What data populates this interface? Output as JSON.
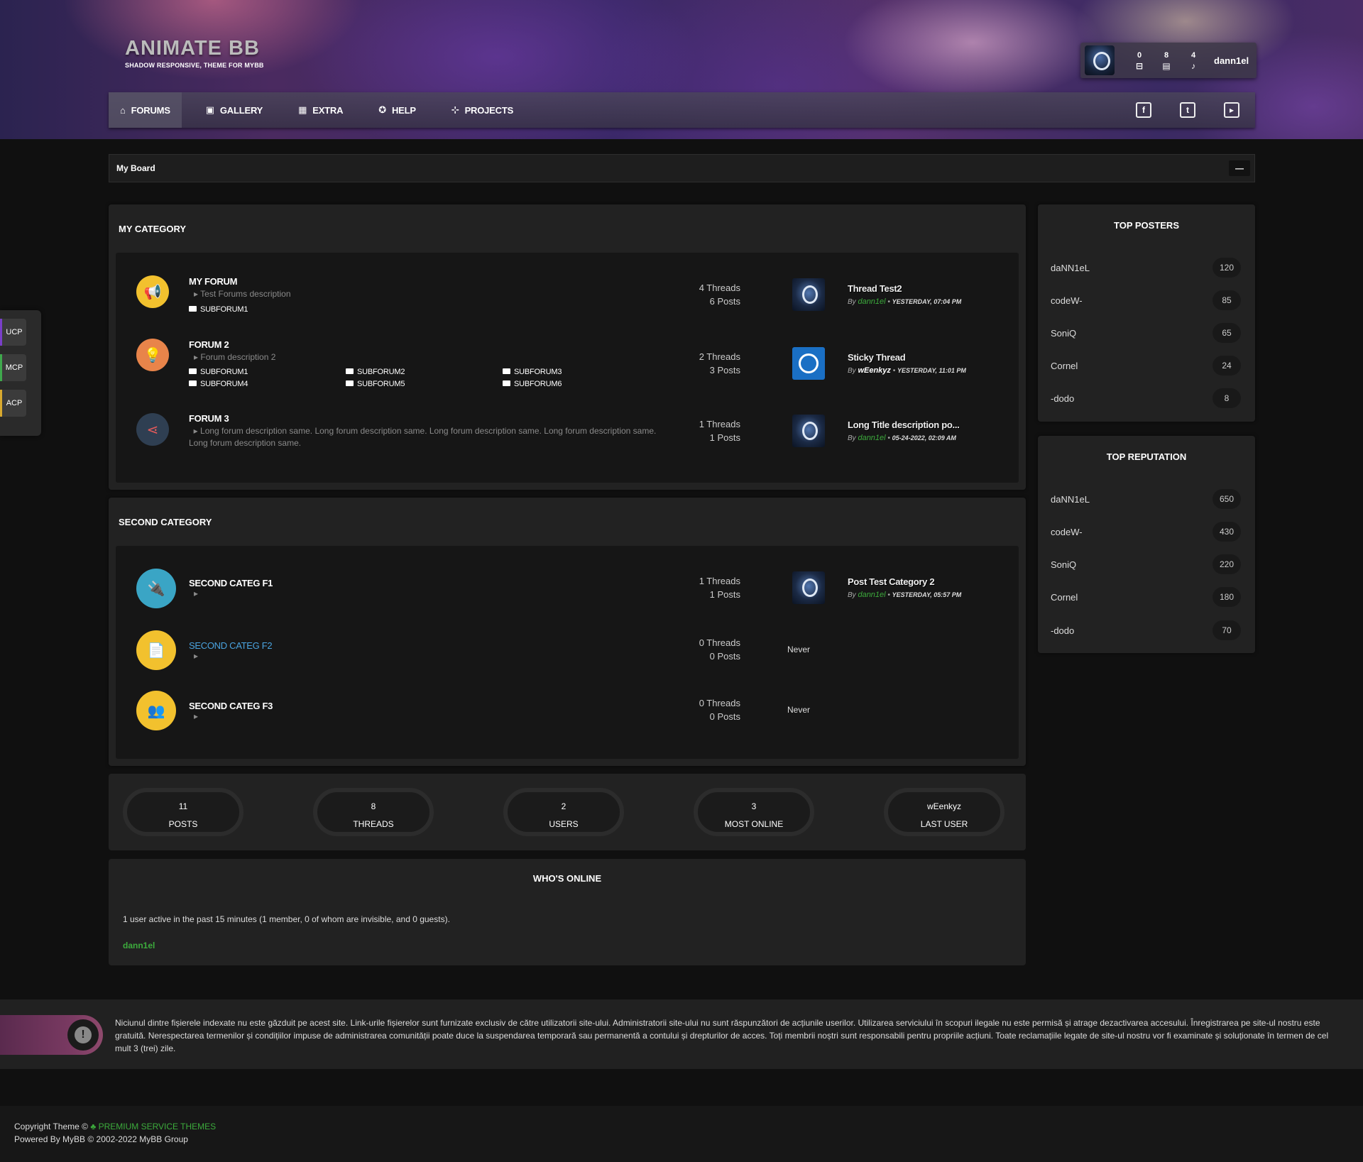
{
  "header": {
    "title": "ANIMATE BB",
    "subtitle": "SHADOW RESPONSIVE, THEME FOR MYBB"
  },
  "user": {
    "inbox": "0",
    "messages": "8",
    "notifications": "4",
    "name": "dann1el"
  },
  "nav": [
    {
      "label": "FORUMS",
      "icon": "home-icon"
    },
    {
      "label": "GALLERY",
      "icon": "image-icon"
    },
    {
      "label": "EXTRA",
      "icon": "grid-icon"
    },
    {
      "label": "HELP",
      "icon": "help-icon"
    },
    {
      "label": "PROJECTS",
      "icon": "sitemap-icon"
    }
  ],
  "social": [
    "facebook-icon",
    "twitter-icon",
    "youtube-icon"
  ],
  "breadcrumb": "My Board",
  "collapse": "—",
  "sidetabs": [
    "UCP",
    "MCP",
    "ACP"
  ],
  "categories": [
    {
      "title": "MY CATEGORY",
      "forums": [
        {
          "name": "MY FORUM",
          "desc": "Test Forums description",
          "subforums": [
            "SUBFORUM1"
          ],
          "threads": "4 Threads",
          "posts": "6 Posts",
          "last_title": "Thread Test2",
          "by": "By",
          "last_user": "dann1el",
          "last_date": "YESTERDAY, 07:04 PM",
          "icon_color": "#f2c12e"
        },
        {
          "name": "FORUM 2",
          "desc": "Forum description 2",
          "subforums": [
            "SUBFORUM1",
            "SUBFORUM2",
            "SUBFORUM3",
            "SUBFORUM4",
            "SUBFORUM5",
            "SUBFORUM6"
          ],
          "threads": "2 Threads",
          "posts": "3 Posts",
          "last_title": "Sticky Thread",
          "by": "By",
          "last_user": "wEenkyz",
          "last_date": "YESTERDAY, 11:01 PM",
          "icon_color": "#e8844a"
        },
        {
          "name": "FORUM 3",
          "desc": "Long forum description same. Long forum description same. Long forum description same. Long forum description same. Long forum description same.",
          "subforums": [],
          "threads": "1 Threads",
          "posts": "1 Posts",
          "last_title": "Long Title description po...",
          "by": "By",
          "last_user": "dann1el",
          "last_date": "05-24-2022, 02:09 AM",
          "icon_color": "#2f3f52"
        }
      ]
    },
    {
      "title": "SECOND CATEGORY",
      "forums": [
        {
          "name": "SECOND CATEG F1",
          "threads": "1 Threads",
          "posts": "1 Posts",
          "last_title": "Post Test Category 2",
          "by": "By",
          "last_user": "dann1el",
          "last_date": "YESTERDAY, 05:57 PM",
          "icon_color": "#3aa5c5"
        },
        {
          "name": "SECOND CATEG F2",
          "threads": "0 Threads",
          "posts": "0 Posts",
          "last": "Never",
          "icon_color": "#f2c12e"
        },
        {
          "name": "SECOND CATEG F3",
          "threads": "0 Threads",
          "posts": "0 Posts",
          "last": "Never",
          "icon_color": "#f2c12e"
        }
      ]
    }
  ],
  "top_posters": {
    "title": "TOP POSTERS",
    "rows": [
      {
        "name": "daNN1eL",
        "value": "120"
      },
      {
        "name": "codeW-",
        "value": "85"
      },
      {
        "name": "SoniQ",
        "value": "65"
      },
      {
        "name": "Cornel",
        "value": "24"
      },
      {
        "name": "-dodo",
        "value": "8"
      }
    ]
  },
  "top_reputation": {
    "title": "TOP REPUTATION",
    "rows": [
      {
        "name": "daNN1eL",
        "value": "650"
      },
      {
        "name": "codeW-",
        "value": "430"
      },
      {
        "name": "SoniQ",
        "value": "220"
      },
      {
        "name": "Cornel",
        "value": "180"
      },
      {
        "name": "-dodo",
        "value": "70"
      }
    ]
  },
  "stats": [
    {
      "value": "11",
      "label": "POSTS"
    },
    {
      "value": "8",
      "label": "THREADS"
    },
    {
      "value": "2",
      "label": "USERS"
    },
    {
      "value": "3",
      "label": "MOST ONLINE"
    },
    {
      "value": "wEenkyz",
      "label": "LAST USER"
    }
  ],
  "whos_online": {
    "title": "WHO'S ONLINE",
    "text": "1 user active in the past 15 minutes (1 member, 0 of whom are invisible, and 0 guests).",
    "users": "dann1el"
  },
  "disclaimer": "Niciunul dintre fișierele indexate nu este găzduit pe acest site. Link-urile fișierelor sunt furnizate exclusiv de către utilizatorii site-ului. Administratorii site-ului nu sunt răspunzători de acțiunile userilor. Utilizarea serviciului în scopuri ilegale nu este permisă și atrage dezactivarea accesului. Înregistrarea pe site-ul nostru este gratuită. Nerespectarea termenilor și condițiilor impuse de administrarea comunității poate duce la suspendarea temporară sau permanentă a contului și drepturilor de acces. Toți membrii noștri sunt responsabili pentru propriile acțiuni. Toate reclamațiile legate de site-ul nostru vor fi examinate și soluționate în termen de cel mult 3 (trei) zile.",
  "footer": {
    "copyright": "Copyright Theme ©",
    "brand": "PREMIUM SERVICE THEMES",
    "powered": "Powered By MyBB © 2002-2022 MyBB Group"
  }
}
